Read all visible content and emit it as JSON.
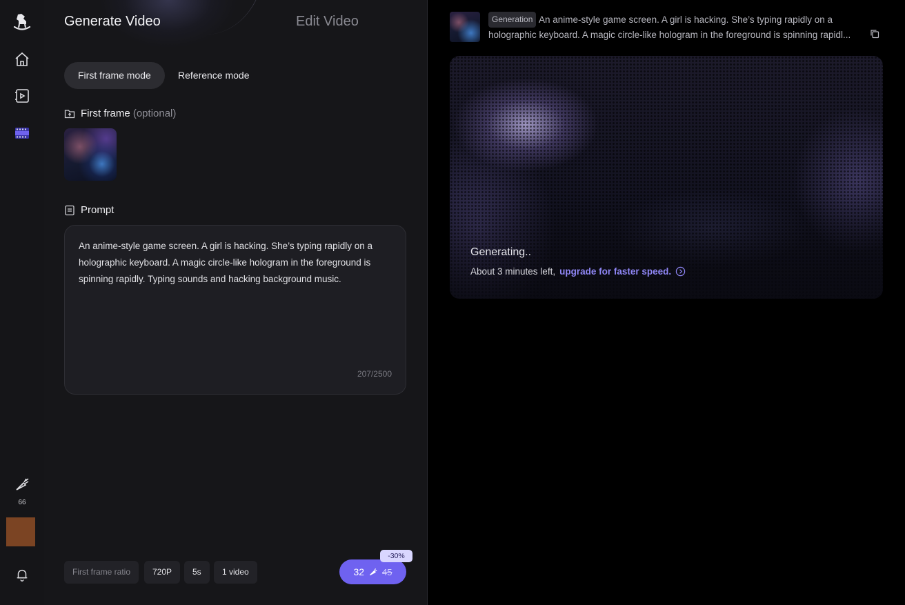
{
  "sidebar": {
    "credits": "66"
  },
  "tabs": {
    "generate": "Generate Video",
    "edit": "Edit Video"
  },
  "modes": {
    "first_frame": "First frame mode",
    "reference": "Reference mode"
  },
  "first_frame": {
    "label": "First frame",
    "optional": "(optional)"
  },
  "prompt": {
    "label": "Prompt",
    "text": "An anime-style game screen. A girl is hacking. She’s typing rapidly on a holographic keyboard. A magic circle-like hologram in the foreground is spinning rapidly. Typing sounds and hacking background music.",
    "counter": "207/2500"
  },
  "options": {
    "ratio": "First frame ratio",
    "resolution": "720P",
    "duration": "5s",
    "count": "1 video"
  },
  "generate_button": {
    "cost": "32",
    "original_cost": "45",
    "discount": "-30%"
  },
  "result": {
    "tag": "Generation",
    "description": "An anime-style game screen. A girl is hacking. She’s typing rapidly on a holographic keyboard. A magic circle-like hologram in the foreground is spinning rapidl...",
    "status": "Generating..",
    "time_left": "About 3 minutes left,",
    "upgrade_link": "upgrade for faster speed."
  },
  "colors": {
    "accent": "#6f62f0",
    "link": "#8f86f5",
    "panel_bg": "#161619",
    "sidebar_bg": "#151518"
  },
  "icons": [
    "rocking-horse-logo-icon",
    "home-icon",
    "video-play-icon",
    "film-strip-icon",
    "carrot-credits-icon",
    "bell-icon",
    "upload-frame-icon",
    "document-icon",
    "copy-icon",
    "chevron-right-circle-icon"
  ]
}
